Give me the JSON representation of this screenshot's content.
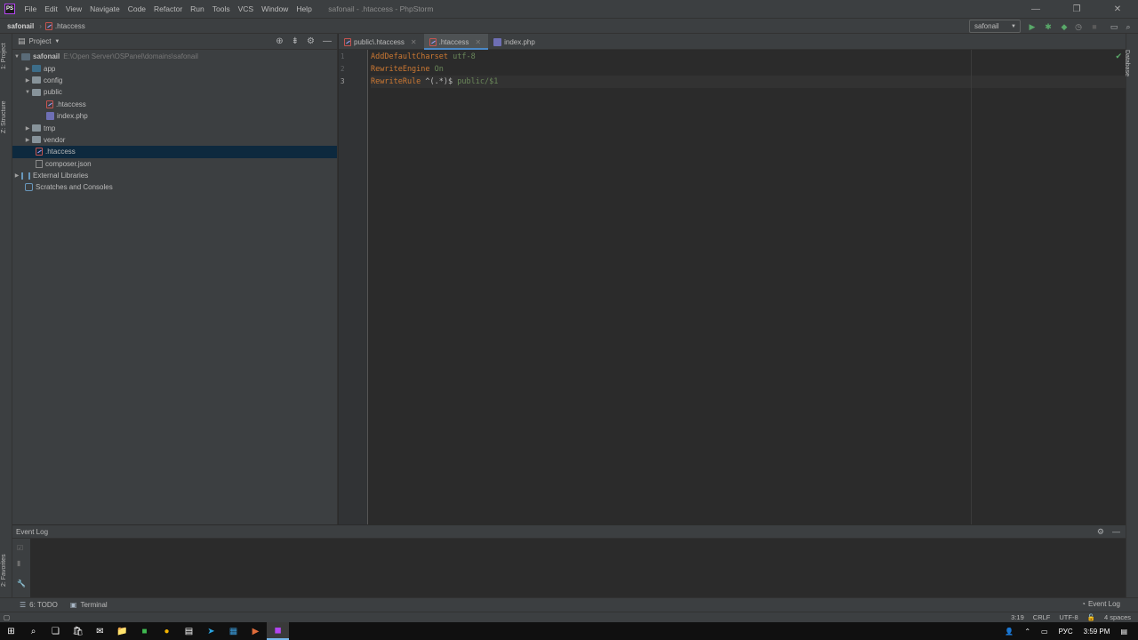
{
  "window": {
    "title": "safonail - .htaccess - PhpStorm",
    "menu": [
      "File",
      "Edit",
      "View",
      "Navigate",
      "Code",
      "Refactor",
      "Run",
      "Tools",
      "VCS",
      "Window",
      "Help"
    ],
    "controls": {
      "minimize": "—",
      "restore": "❐",
      "close": "✕"
    }
  },
  "navbar": {
    "project": "safonail",
    "file": ".htaccess",
    "run_config": "safonail"
  },
  "left_stripe": {
    "project_tab": "1: Project",
    "structure_tab": "Z: Structure",
    "favorites_tab": "2: Favorites"
  },
  "right_stripe": {
    "database_tab": "Database"
  },
  "project_panel": {
    "title": "Project",
    "root_name": "safonail",
    "root_path": "E:\\Open Server\\OSPanel\\domains\\safonail",
    "items": [
      {
        "label": "app"
      },
      {
        "label": "config"
      },
      {
        "label": "public"
      },
      {
        "label": ".htaccess"
      },
      {
        "label": "index.php"
      },
      {
        "label": "tmp"
      },
      {
        "label": "vendor"
      },
      {
        "label": ".htaccess"
      },
      {
        "label": "composer.json"
      },
      {
        "label": "External Libraries"
      },
      {
        "label": "Scratches and Consoles"
      }
    ]
  },
  "editor": {
    "tabs": [
      {
        "label": "public\\.htaccess"
      },
      {
        "label": ".htaccess"
      },
      {
        "label": "index.php"
      }
    ],
    "line_numbers": [
      "1",
      "2",
      "3"
    ],
    "lines": [
      {
        "directive": "AddDefaultCharset",
        "value": "utf-8"
      },
      {
        "directive": "RewriteEngine",
        "value": "On"
      },
      {
        "directive": "RewriteRule",
        "pattern": "^(.*)$",
        "value": "public/$1"
      }
    ]
  },
  "event_log": {
    "title": "Event Log"
  },
  "toolstrip": {
    "todo": "6: TODO",
    "terminal": "Terminal",
    "event_log": "Event Log"
  },
  "status": {
    "position": "3:19",
    "line_sep": "CRLF",
    "encoding": "UTF-8",
    "indent": "4 spaces"
  },
  "taskbar": {
    "language": "РУС",
    "time": "3:59 PM"
  }
}
